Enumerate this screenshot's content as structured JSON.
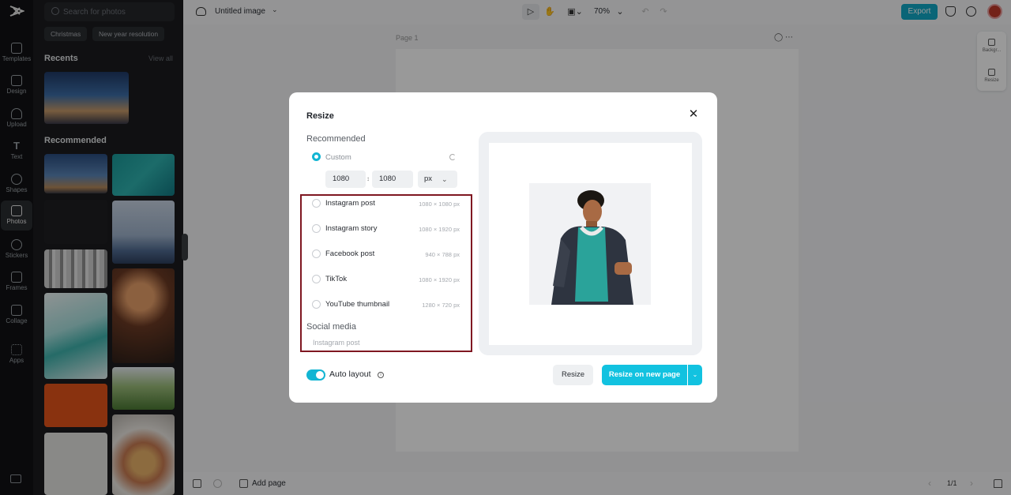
{
  "app": {
    "logo_icon": "capcut-logo-icon",
    "accent_color": "#12b5d3",
    "export_color": "#12a9c7"
  },
  "rail": {
    "items": [
      {
        "label": "Templates",
        "icon": "templates-icon"
      },
      {
        "label": "Design",
        "icon": "design-icon"
      },
      {
        "label": "Upload",
        "icon": "upload-icon"
      },
      {
        "label": "Text",
        "icon": "text-icon"
      },
      {
        "label": "Shapes",
        "icon": "shapes-icon"
      },
      {
        "label": "Photos",
        "icon": "photos-icon",
        "active": true
      },
      {
        "label": "Stickers",
        "icon": "stickers-icon"
      },
      {
        "label": "Frames",
        "icon": "frames-icon"
      },
      {
        "label": "Collage",
        "icon": "collage-icon"
      },
      {
        "label": "Apps",
        "icon": "apps-icon"
      }
    ]
  },
  "panel": {
    "search_placeholder": "Search for photos",
    "chips": [
      "Christmas",
      "New year resolution"
    ],
    "recents_title": "Recents",
    "view_all": "View all",
    "recommended_title": "Recommended"
  },
  "topbar": {
    "title": "Untitled image",
    "zoom": "70%",
    "export_label": "Export"
  },
  "canvas": {
    "page_label": "Page 1",
    "float_menu": [
      "Backgr...",
      "Resize"
    ]
  },
  "bottombar": {
    "add_page_label": "Add page",
    "pager": "1/1"
  },
  "modal": {
    "title": "Resize",
    "recommended_label": "Recommended",
    "custom_label": "Custom",
    "width_value": "1080",
    "height_value": "1080",
    "unit_value": "px",
    "options": [
      {
        "label": "Instagram post",
        "size": "1080 × 1080 px"
      },
      {
        "label": "Instagram story",
        "size": "1080 × 1920 px"
      },
      {
        "label": "Facebook post",
        "size": "940 × 788 px"
      },
      {
        "label": "TikTok",
        "size": "1080 × 1920 px"
      },
      {
        "label": "YouTube thumbnail",
        "size": "1280 × 720 px"
      }
    ],
    "social_media_label": "Social media",
    "social_media_sub": "Instagram post",
    "auto_layout_label": "Auto layout",
    "auto_layout_on": true,
    "resize_label": "Resize",
    "resize_new_page_label": "Resize on new page"
  }
}
